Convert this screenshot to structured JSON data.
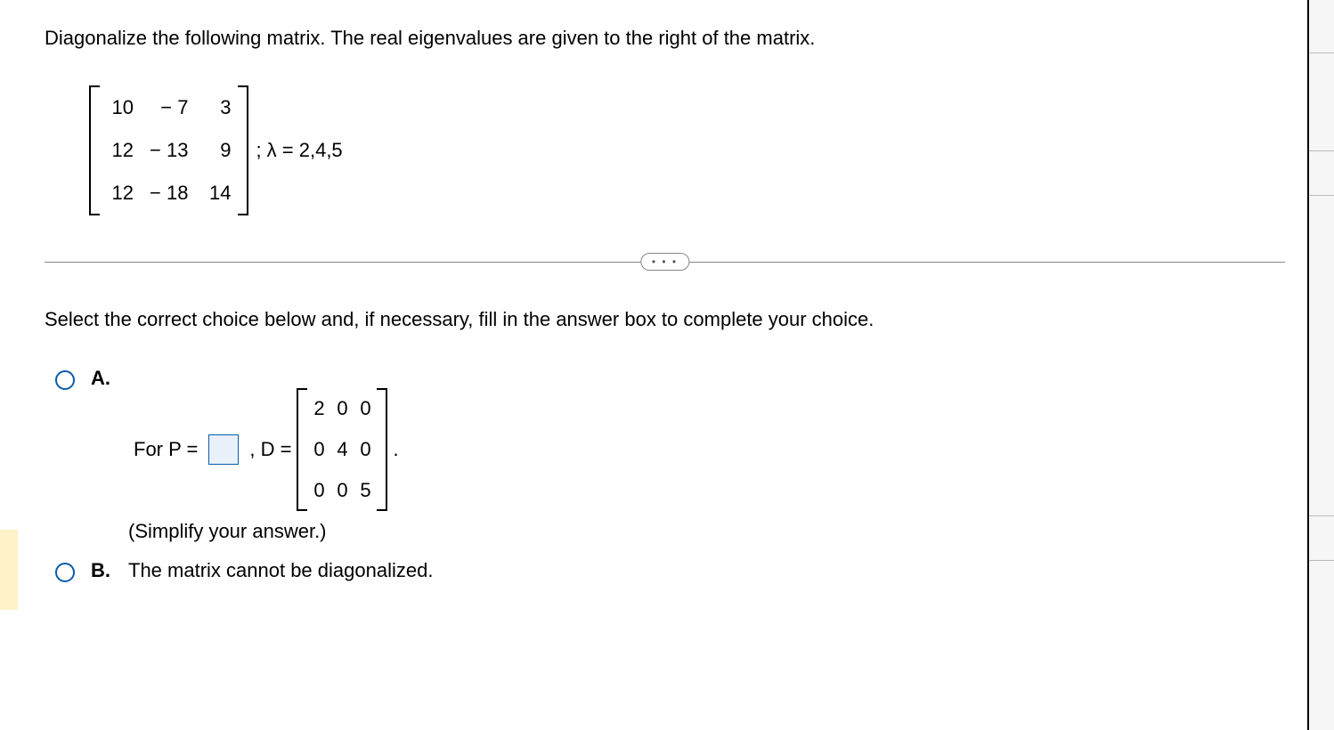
{
  "question": "Diagonalize the following matrix. The real eigenvalues are given to the right of the matrix.",
  "matrix": {
    "r1": {
      "c1": "10",
      "c2": "− 7",
      "c3": "3"
    },
    "r2": {
      "c1": "12",
      "c2": "− 13",
      "c3": "9"
    },
    "r3": {
      "c1": "12",
      "c2": "− 18",
      "c3": "14"
    }
  },
  "eigen_text": "; λ = 2,4,5",
  "divider_dots": "• • •",
  "instruction": "Select the correct choice below and, if necessary, fill in the answer box to complete your choice.",
  "choiceA": {
    "label": "A.",
    "for_p_prefix": "For P =",
    "d_equals": ", D =",
    "period": ".",
    "D": {
      "r1": {
        "c1": "2",
        "c2": "0",
        "c3": "0"
      },
      "r2": {
        "c1": "0",
        "c2": "4",
        "c3": "0"
      },
      "r3": {
        "c1": "0",
        "c2": "0",
        "c3": "5"
      }
    },
    "simplify": "(Simplify your answer.)"
  },
  "choiceB": {
    "label": "B.",
    "text": "The matrix cannot be diagonalized."
  }
}
